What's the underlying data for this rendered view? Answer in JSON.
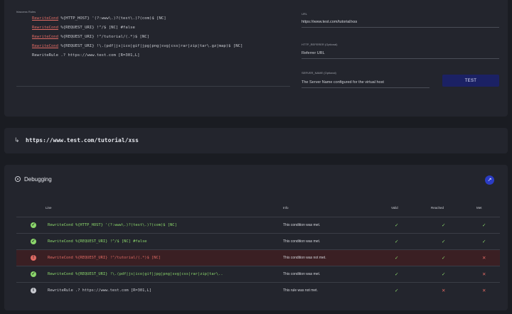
{
  "top": {
    "rules_label": "htaccess Rules",
    "rules": [
      {
        "kw": "RewriteCond",
        "rest": " %{HTTP_HOST} '(?:www\\.)?(test\\.)?(com)$ [NC]"
      },
      {
        "kw": "RewriteCond",
        "rest": " %{REQUEST_URI} !^/$ [NC] #false"
      },
      {
        "kw": "RewriteCond",
        "rest": " %{REQUEST_URI} !^/tutorial/(.*)$ [NC]"
      },
      {
        "kw": "RewriteCond",
        "rest": " %{REQUEST_URI} !\\.(pdf|js|ico|gif|jpg|png|svg|css|rar|zip|tar\\.gz|map)$ [NC]"
      },
      {
        "kw": "",
        "rest": "RewriteRule .? https://www.test.com [R=301,L]"
      }
    ],
    "url_label": "URL",
    "url_value": "https://www.test.com/tutorial/xss",
    "referer_label": "HTTP_REFERER (Optional)",
    "referer_placeholder": "Referrer URL",
    "server_label": "SERVER_NAME (Optional)",
    "server_placeholder": "The Server Name configured for the virtual host",
    "test_button": "TEST"
  },
  "result": {
    "arrow": "↳",
    "url": "https://www.test.com/tutorial/xss"
  },
  "debug": {
    "title": "Debugging",
    "share_icon": "↗",
    "headers": {
      "line": "Line",
      "info": "Info",
      "valid": "Valid",
      "reached": "Reached",
      "met": "Met"
    },
    "rows": [
      {
        "status": "ok",
        "line": "RewriteCond %{HTTP_HOST} '(?:www\\.)?(test\\.)?(com)$ [NC]",
        "info": "This condition was met.",
        "valid": "✓",
        "reached": "✓",
        "met": "✓"
      },
      {
        "status": "ok",
        "line": "RewriteCond %{REQUEST_URI} !^/$ [NC] #false",
        "info": "This condition was met.",
        "valid": "✓",
        "reached": "✓",
        "met": "✓"
      },
      {
        "status": "err",
        "line": "RewriteCond %{REQUEST_URI} !^/tutorial/(.*)$ [NC]",
        "info": "This condition was not met.",
        "valid": "✓",
        "reached": "✓",
        "met": "✕"
      },
      {
        "status": "ok",
        "line": "RewriteCond %{REQUEST_URI} !\\.(pdf|js|ico|gif|jpg|png|svg|css|rar|zip|tar\\..",
        "info": "This condition was met.",
        "valid": "✓",
        "reached": "✓",
        "met": "✕"
      },
      {
        "status": "gray",
        "line": "RewriteRule .? https://www.test.com [R=301,L]",
        "info": "This rule was not met.",
        "valid": "✓",
        "reached": "✕",
        "met": "✕"
      }
    ]
  },
  "colors": {
    "met": "#8bd66b",
    "failed": "#e06a63",
    "button": "#1b2164",
    "share": "#2b3cc4"
  }
}
